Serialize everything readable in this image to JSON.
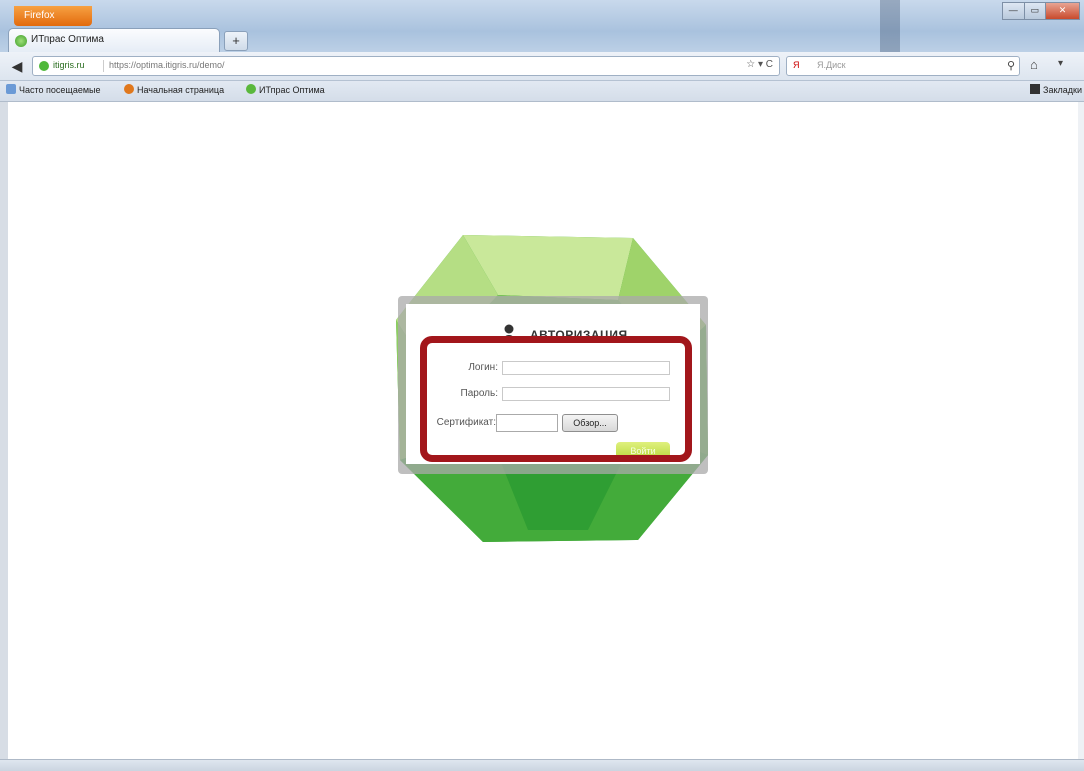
{
  "browser": {
    "app_button_label": "Firefox",
    "window_controls": [
      "—",
      "▭",
      "✕"
    ],
    "tab": {
      "title": "ИТпрас Оптима"
    },
    "new_tab_label": "+",
    "identity_label": "itigris.ru",
    "url": "https://optima.itigris.ru/demo/",
    "search_engine": "Я",
    "search_placeholder": "Я.Диск",
    "bookmarks": [
      {
        "label": "Часто посещаемые",
        "color": "#6b9ad6"
      },
      {
        "label": "Начальная страница",
        "color": "#e0781d"
      },
      {
        "label": "ИТпрас Оптима",
        "color": "#5ab83c"
      }
    ],
    "bookmarks_menu_label": "Закладки"
  },
  "login": {
    "title": "АВТОРИЗАЦИЯ",
    "login_label": "Логин:",
    "password_label": "Пароль:",
    "certificate_label": "Сертификат:",
    "browse_label": "Обзор...",
    "submit_label": "Войти"
  },
  "colors": {
    "highlight": "#a2161b",
    "gem_light": "#c9e89a",
    "gem_dark": "#3aa836"
  }
}
